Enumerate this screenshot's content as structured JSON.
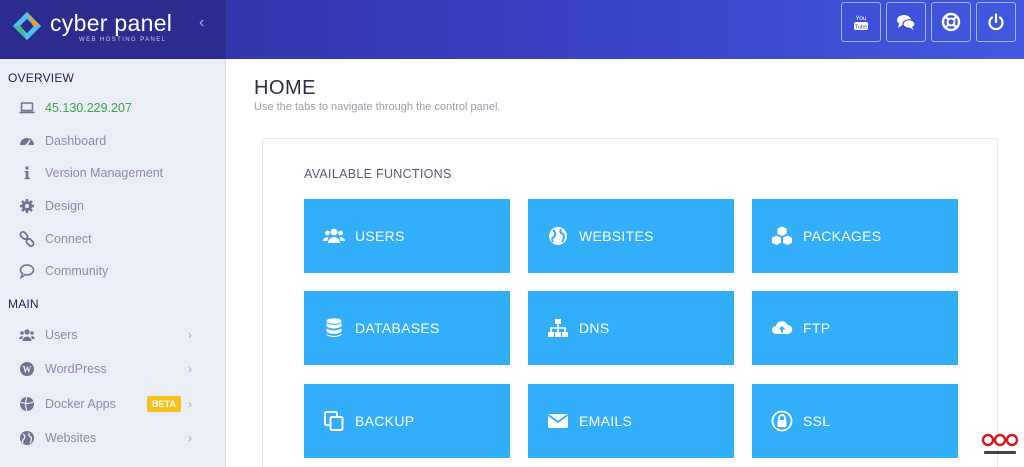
{
  "brand": {
    "name": "cyber panel",
    "subtitle": "WEB HOSTING PANEL",
    "collapse_icon": "chevron-left-icon"
  },
  "header_buttons": [
    {
      "name": "youtube-button",
      "icon": "youtube-icon"
    },
    {
      "name": "chat-button",
      "icon": "chat-icon"
    },
    {
      "name": "support-button",
      "icon": "lifebuoy-icon"
    },
    {
      "name": "logout-button",
      "icon": "power-icon"
    }
  ],
  "sidebar": {
    "overview_title": "OVERVIEW",
    "main_title": "MAIN",
    "overview_items": [
      {
        "label": "45.130.229.207",
        "icon": "laptop-icon"
      },
      {
        "label": "Dashboard",
        "icon": "dashboard-icon"
      },
      {
        "label": "Version Management",
        "icon": "info-icon"
      },
      {
        "label": "Design",
        "icon": "gear-icon"
      },
      {
        "label": "Connect",
        "icon": "link-icon"
      },
      {
        "label": "Community",
        "icon": "comment-icon"
      }
    ],
    "main_items": [
      {
        "label": "Users",
        "icon": "users-icon",
        "chevron": "›"
      },
      {
        "label": "WordPress",
        "icon": "wordpress-icon",
        "chevron": "›"
      },
      {
        "label": "Docker Apps",
        "icon": "docker-icon",
        "chevron": "›",
        "badge": "BETA"
      },
      {
        "label": "Websites",
        "icon": "globe-icon",
        "chevron": "›"
      }
    ]
  },
  "main": {
    "title": "HOME",
    "subtitle": "Use the tabs to navigate through the control panel.",
    "panel_title": "AVAILABLE FUNCTIONS",
    "tiles": [
      {
        "label": "USERS",
        "icon": "users-icon"
      },
      {
        "label": "WEBSITES",
        "icon": "globe-icon"
      },
      {
        "label": "PACKAGES",
        "icon": "cubes-icon"
      },
      {
        "label": "DATABASES",
        "icon": "database-icon"
      },
      {
        "label": "DNS",
        "icon": "sitemap-icon"
      },
      {
        "label": "FTP",
        "icon": "cloud-upload-icon"
      },
      {
        "label": "BACKUP",
        "icon": "copy-icon"
      },
      {
        "label": "EMAILS",
        "icon": "envelope-icon"
      },
      {
        "label": "SSL",
        "icon": "lock-icon"
      }
    ]
  },
  "colors": {
    "header": "#3a41c4",
    "sidebar": "#eceef7",
    "tile": "#33aef8",
    "ip": "#3aa24a",
    "badge": "#f4c21a"
  }
}
